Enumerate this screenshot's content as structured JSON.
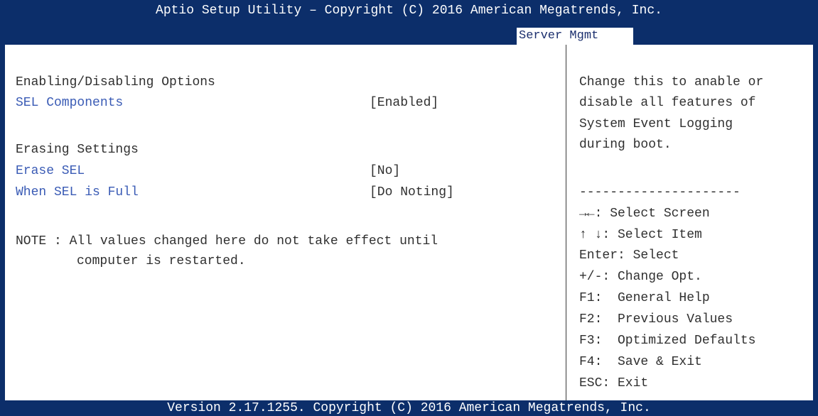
{
  "header": {
    "title": "Aptio Setup Utility – Copyright (C) 2016 American Megatrends, Inc.",
    "active_tab": "Server Mgmt"
  },
  "main": {
    "section_enabling": "Enabling/Disabling Options",
    "sel_components": {
      "label": "SEL Components",
      "value": "[Enabled]"
    },
    "section_erasing": "Erasing Settings",
    "erase_sel": {
      "label": "Erase SEL",
      "value": "[No]"
    },
    "when_full": {
      "label": "When SEL is Full",
      "value": "[Do Noting]"
    },
    "note_line1": "NOTE : All values changed here do not take effect until",
    "note_line2": "computer is restarted."
  },
  "help": {
    "description": [
      "Change this to anable or",
      "disable all features of",
      "System Event Logging",
      "during boot."
    ],
    "separator": "---------------------",
    "keys": [
      "→←: Select Screen",
      "↑ ↓: Select Item",
      "Enter: Select",
      "+/-: Change Opt.",
      "F1:  General Help",
      "F2:  Previous Values",
      "F3:  Optimized Defaults",
      "F4:  Save & Exit",
      "ESC: Exit"
    ]
  },
  "footer": {
    "version": "Version 2.17.1255. Copyright (C) 2016 American Megatrends, Inc."
  },
  "colors": {
    "bar": "#0c2e6a",
    "setting_text": "#3a5bb5",
    "static_text": "#303030"
  }
}
